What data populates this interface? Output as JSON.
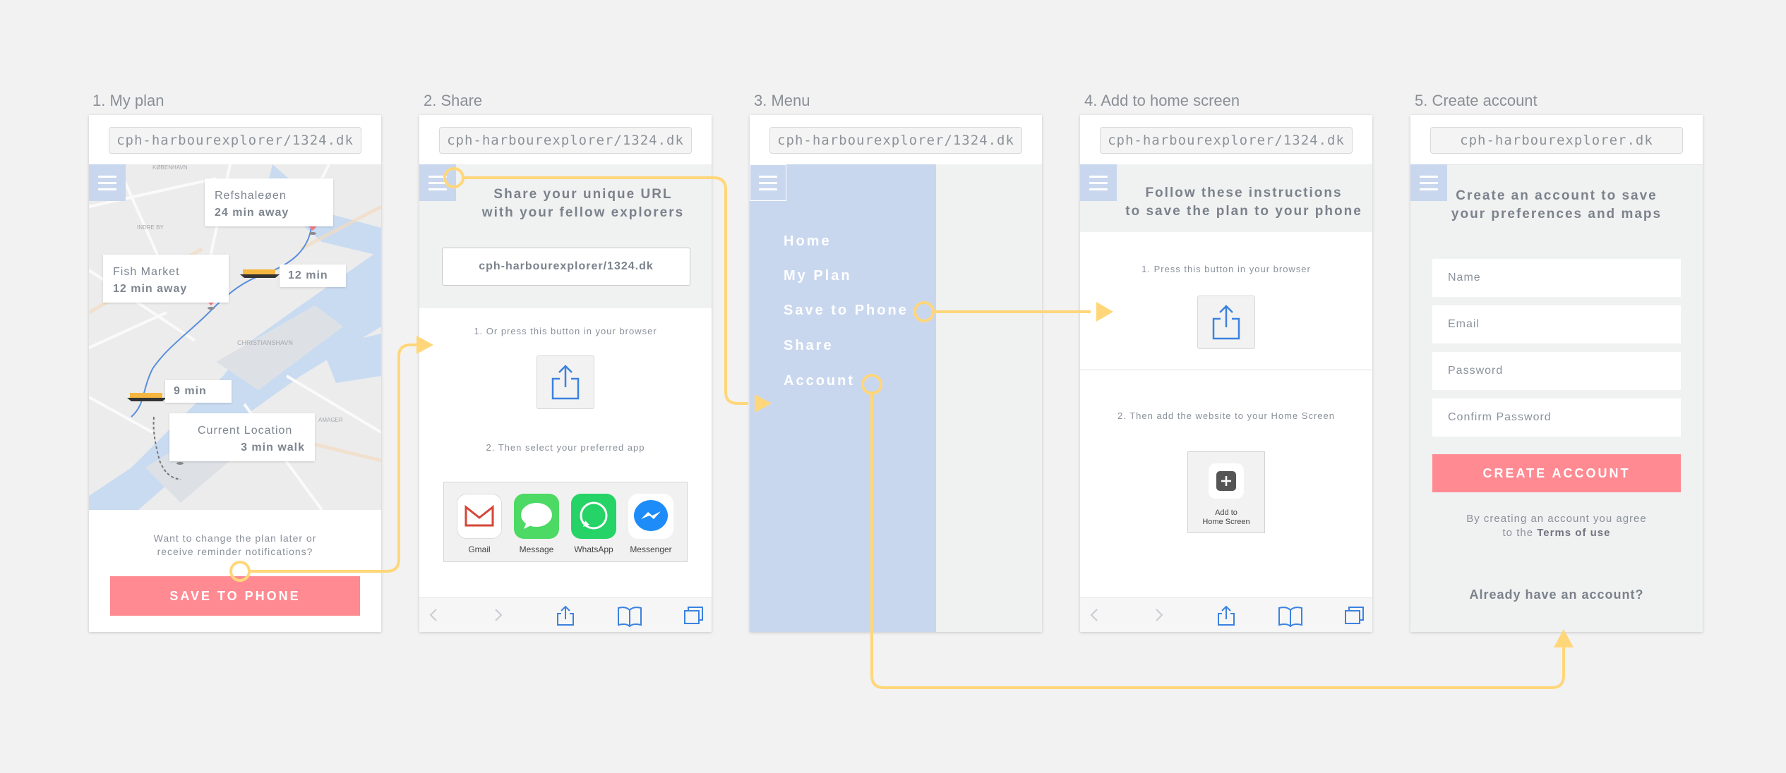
{
  "colors": {
    "accent_pink": "#ff8a92",
    "menu_blue": "#c9d7ee",
    "flow_yellow": "#ffd77a",
    "link_blue": "#3b82e0"
  },
  "screens": [
    {
      "label": "1. My plan",
      "url": "cph-harbourexplorer/1324.dk",
      "map": {
        "places": [
          {
            "name": "Refshaleøen",
            "time": "24 min away"
          },
          {
            "name": "Fish Market",
            "time": "12 min away"
          },
          {
            "name": "Current Location",
            "time": "3 min walk"
          }
        ],
        "legs": [
          "12 min",
          "9 min"
        ],
        "map_text": [
          "KØBENHAVN",
          "INDRE BY",
          "CHRISTIANSHAVN",
          "AMAGER"
        ]
      },
      "prompt": [
        "Want to change the plan later or",
        "receive reminder notifications?"
      ],
      "button": "SAVE TO PHONE"
    },
    {
      "label": "2. Share",
      "url": "cph-harbourexplorer/1324.dk",
      "heading": [
        "Share your unique URL",
        "with your fellow explorers"
      ],
      "share_url": "cph-harbourexplorer/1324.dk",
      "step1": "1. Or press this button in your browser",
      "step2": "2. Then select your preferred app",
      "apps": [
        "Gmail",
        "Message",
        "WhatsApp",
        "Messenger"
      ]
    },
    {
      "label": "3. Menu",
      "url": "cph-harbourexplorer/1324.dk",
      "menu": [
        "Home",
        "My Plan",
        "Save to Phone",
        "Share",
        "Account"
      ]
    },
    {
      "label": "4. Add to home screen",
      "url": "cph-harbourexplorer/1324.dk",
      "heading": [
        "Follow these instructions",
        "to save the plan to your phone"
      ],
      "step1": "1. Press this button in your browser",
      "step2": "2. Then add the website to your Home Screen",
      "home_btn": [
        "Add to",
        "Home Screen"
      ]
    },
    {
      "label": "5. Create account",
      "url": "cph-harbourexplorer.dk",
      "heading": [
        "Create an account to save",
        "your preferences and maps"
      ],
      "fields": [
        "Name",
        "Email",
        "Password",
        "Confirm Password"
      ],
      "button": "CREATE ACCOUNT",
      "terms": [
        "By creating an account you agree",
        "to the",
        "Terms of use"
      ],
      "login": "Already have an account?"
    }
  ]
}
